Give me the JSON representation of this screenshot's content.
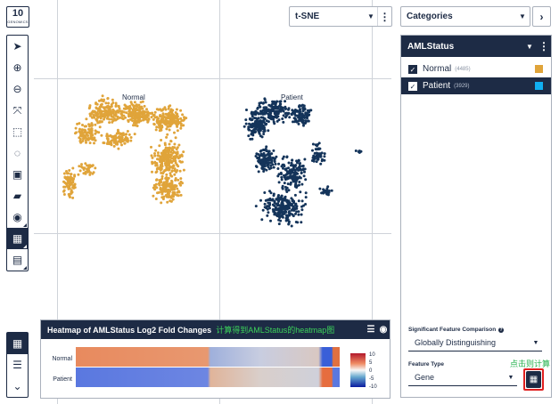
{
  "logo": {
    "big": "10",
    "small": "GENOMICS"
  },
  "toolbar": {
    "tools": [
      {
        "name": "pointer-tool",
        "icon": "cursor-icon",
        "glyph": "➤",
        "active": false
      },
      {
        "name": "zoom-in-tool",
        "icon": "zoom-in-icon",
        "glyph": "⊕",
        "active": false
      },
      {
        "name": "zoom-out-tool",
        "icon": "zoom-out-icon",
        "glyph": "⊖",
        "active": false
      },
      {
        "name": "fit-view-tool",
        "icon": "expand-icon",
        "glyph": "⤧",
        "active": false
      },
      {
        "name": "rect-select-tool",
        "icon": "rect-select-icon",
        "glyph": "⬚",
        "active": false
      },
      {
        "name": "lasso-tool",
        "icon": "lasso-icon",
        "glyph": "◌",
        "active": false
      },
      {
        "name": "save-tool",
        "icon": "save-icon",
        "glyph": "▣",
        "active": false
      },
      {
        "name": "open-tool",
        "icon": "folder-icon",
        "glyph": "▰",
        "active": false
      },
      {
        "name": "screenshot-tool",
        "icon": "camera-icon",
        "glyph": "◉",
        "active": false
      },
      {
        "name": "layout-tool",
        "icon": "grid-icon",
        "glyph": "▦",
        "active": true
      },
      {
        "name": "export-tool",
        "icon": "clipboard-icon",
        "glyph": "▤",
        "active": false
      }
    ],
    "bottom_tools": [
      {
        "name": "grid-view-button",
        "icon": "grid-icon",
        "glyph": "▦",
        "active": true
      },
      {
        "name": "list-view-button",
        "icon": "list-icon",
        "glyph": "☰",
        "active": false
      },
      {
        "name": "collapse-button",
        "icon": "chevron-down-icon",
        "glyph": "⌄",
        "active": false
      }
    ]
  },
  "projection": {
    "label": "t-SNE",
    "caret": "▼",
    "menu": "⋮"
  },
  "categories": {
    "label": "Categories",
    "caret": "▼",
    "next": "›"
  },
  "panel": {
    "title": "AMLStatus",
    "caret": "▼",
    "menu": "⋮",
    "items": [
      {
        "name": "Normal",
        "count": "(4485)",
        "color": "#e0a43a",
        "selected": false
      },
      {
        "name": "Patient",
        "count": "(3929)",
        "color": "#10aef0",
        "selected": true
      }
    ]
  },
  "significance": {
    "label": "Significant Feature Comparison",
    "help": "?",
    "value": "Globally Distinguishing"
  },
  "feature_type": {
    "label": "Feature Type",
    "value": "Gene"
  },
  "calc_annotation": "点击则计算",
  "heatmap": {
    "title": "Heatmap of AMLStatus Log2 Fold Changes",
    "annotation": "计算得到AMLStatus的heatmap图",
    "icon_settings": "☰",
    "icon_camera": "◉",
    "rows": [
      "Normal",
      "Patient"
    ],
    "scale_ticks": [
      "10",
      "5",
      "0",
      "-5",
      "-10"
    ]
  },
  "chart_data": {
    "type": "scatter",
    "projection": "t-SNE",
    "cluster_labels": [
      "Normal",
      "Patient"
    ],
    "colors": {
      "Normal": "#e0a43a",
      "Patient": "#14345a"
    }
  },
  "colors": {
    "navy": "#1d2b45",
    "normal": "#e0a43a",
    "patient_scatter": "#14345a",
    "patient_legend": "#10aef0",
    "highlight": "#e02020",
    "annotation": "#22b14c"
  }
}
